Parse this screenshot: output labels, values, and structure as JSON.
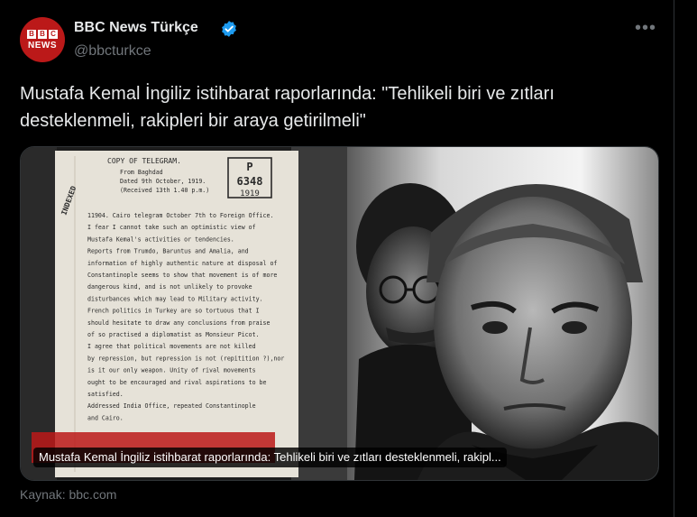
{
  "account": {
    "display_name": "BBC News Türkçe",
    "handle": "@bbcturkce",
    "avatar_blocks": [
      "B",
      "B",
      "C"
    ],
    "avatar_label": "NEWS",
    "verified_color": "#1d9bf0",
    "brand_color": "#bb1919"
  },
  "menu": {
    "more_label": "•••"
  },
  "tweet": {
    "text": "Mustafa Kemal İngiliz istihbarat raporlarında: \"Tehlikeli biri ve zıtları desteklenmeli, rakipleri bir araya getirilmeli\""
  },
  "card": {
    "caption": "Mustafa Kemal İngiliz istihbarat raporlarında: Tehlikeli biri ve zıtları desteklenmeli, rakipl...",
    "document": {
      "header": "COPY OF TELEGRAM.",
      "stamp_letter": "P",
      "stamp_number": "6348",
      "stamp_year": "1919",
      "margin_note": "INDEXED",
      "lines": [
        "From Baghdad",
        "Dated 9th October, 1919.",
        "(Received 13th 1.40 p.m.)",
        "11904.  Cairo telegram October 7th to Foreign Office.",
        "I fear I cannot take such an optimistic view of",
        "Mustafa Kemal's activities or tendencies.",
        "Reports from Trumdo, Baruntus and Amalia, and",
        "information of highly authentic nature at disposal of",
        "Constantinople seems to show that movement is of more",
        "dangerous kind, and is not unlikely to provoke",
        "disturbances which may lead to Military activity.",
        "French politics in Turkey are so tortuous that I",
        "should hesitate to draw any conclusions from praise",
        "of so practised a diplomatist as Monsieur Picot.",
        "I agree that political movements are not killed",
        "by repression, but repression is not (repitition ?),nor",
        "is it our only weapon.   Unity of rival movements",
        "ought to be encouraged and rival aspirations to be",
        "satisfied.",
        "Addressed India Office, repeated Constantinople",
        "and Cairo."
      ]
    }
  },
  "source": {
    "label": "Kaynak: bbc.com"
  }
}
